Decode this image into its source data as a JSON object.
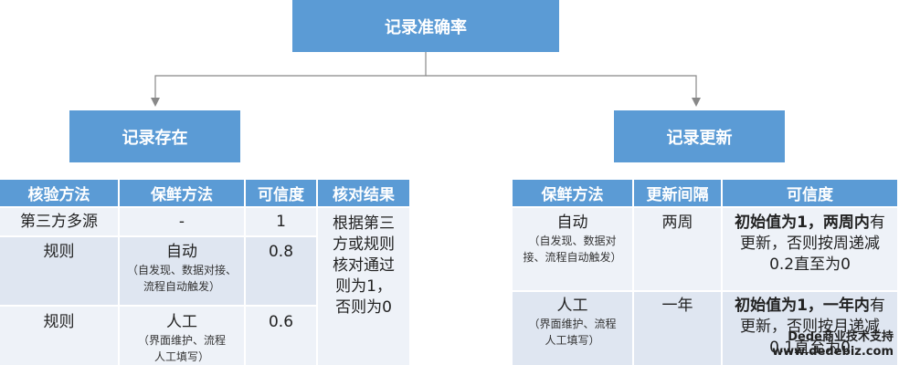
{
  "top": {
    "title": "记录准确率"
  },
  "left_box": {
    "title": "记录存在"
  },
  "right_box": {
    "title": "记录更新"
  },
  "left_table": {
    "headers": [
      "核验方法",
      "保鲜方法",
      "可信度",
      "核对结果"
    ],
    "rows": [
      {
        "method": "第三方多源",
        "fresh_main": "-",
        "fresh_sub": "",
        "cred": "1"
      },
      {
        "method": "规则",
        "fresh_main": "自动",
        "fresh_sub": "（自发现、数据对接、流程自动触发）",
        "cred": "0.8"
      },
      {
        "method": "规则",
        "fresh_main": "人工",
        "fresh_sub": "（界面维护、流程人工填写）",
        "cred": "0.6"
      }
    ],
    "result": "根据第三方或规则核对通过则为1，否则为0"
  },
  "right_table": {
    "headers": [
      "保鲜方法",
      "更新间隔",
      "可信度"
    ],
    "rows": [
      {
        "fresh_main": "自动",
        "fresh_sub": "（自发现、数据对接、流程自动触发）",
        "interval": "两周",
        "cred_bold": "初始值为1，两周内",
        "cred_rest": "有更新，否则按周递减0.2直至为0"
      },
      {
        "fresh_main": "人工",
        "fresh_sub": "（界面维护、流程人工填写）",
        "interval": "一年",
        "cred_bold": "初始值为1，一年内",
        "cred_rest": "有更新，否则按月递减0.1直至为0"
      }
    ]
  },
  "watermark": {
    "line1": "Dede商业技术支持",
    "line2": "www.dedebiz.com"
  }
}
